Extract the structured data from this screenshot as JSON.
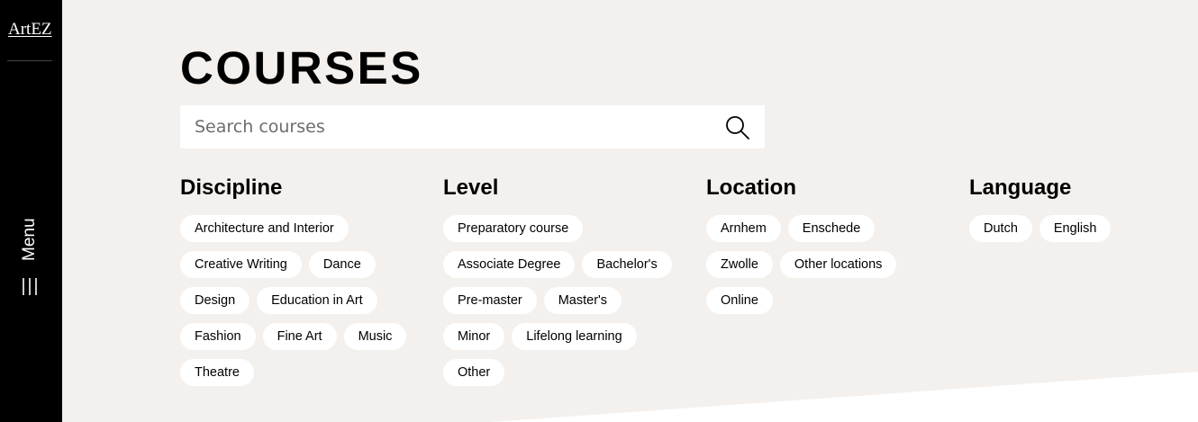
{
  "sidebar": {
    "logo": "ArtEZ",
    "menu_label": "Menu"
  },
  "main": {
    "title": "COURSES",
    "search": {
      "placeholder": "Search courses",
      "value": ""
    },
    "filters": [
      {
        "heading": "Discipline",
        "options": [
          "Architecture and Interior",
          "Creative Writing",
          "Dance",
          "Design",
          "Education in Art",
          "Fashion",
          "Fine Art",
          "Music",
          "Theatre"
        ]
      },
      {
        "heading": "Level",
        "options": [
          "Preparatory course",
          "Associate Degree",
          "Bachelor's",
          "Pre-master",
          "Master's",
          "Minor",
          "Lifelong learning",
          "Other"
        ]
      },
      {
        "heading": "Location",
        "options": [
          "Arnhem",
          "Enschede",
          "Zwolle",
          "Other locations",
          "Online"
        ]
      },
      {
        "heading": "Language",
        "options": [
          "Dutch",
          "English"
        ]
      }
    ]
  },
  "icons": {
    "search": "search-icon",
    "menu": "menu-lines-icon"
  },
  "colors": {
    "background": "#f3f0ed",
    "sidebar": "#000000",
    "chip": "#ffffff",
    "text": "#000000"
  }
}
